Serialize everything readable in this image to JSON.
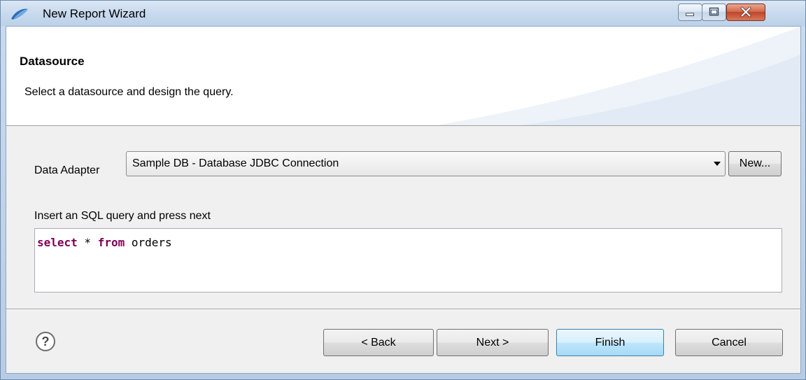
{
  "window": {
    "title": "New Report Wizard",
    "icon": "app-swoosh-icon",
    "controls": {
      "minimize": "minimize-icon",
      "maximize": "maximize-icon",
      "close": "close-icon"
    }
  },
  "header": {
    "title": "Datasource",
    "description": "Select a datasource and design the query."
  },
  "data_adapter": {
    "label": "Data Adapter",
    "selected": "Sample DB - Database JDBC Connection",
    "new_button": "New..."
  },
  "query": {
    "label": "Insert an SQL query and press next",
    "tokens": [
      {
        "text": "select",
        "kind": "keyword"
      },
      {
        "text": " * ",
        "kind": "plain"
      },
      {
        "text": "from",
        "kind": "keyword"
      },
      {
        "text": " orders",
        "kind": "plain"
      }
    ]
  },
  "footer": {
    "help_icon": "help-icon",
    "back": "< Back",
    "next": "Next >",
    "finish": "Finish",
    "cancel": "Cancel"
  },
  "colors": {
    "sql_keyword": "#7f0055",
    "default_button_border": "#3c7fb1",
    "title_bar": "#c8daee"
  }
}
